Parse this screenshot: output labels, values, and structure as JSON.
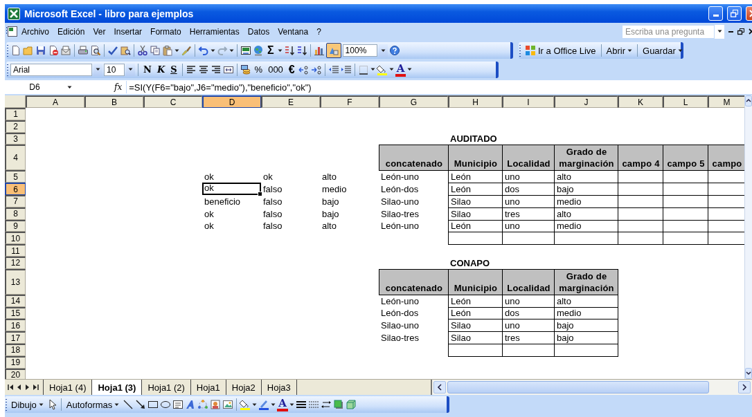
{
  "window": {
    "title": "Microsoft Excel - libro para ejemplos"
  },
  "menu_bar": {
    "items": [
      {
        "label": "Archivo"
      },
      {
        "label": "Edición"
      },
      {
        "label": "Ver"
      },
      {
        "label": "Insertar"
      },
      {
        "label": "Formato"
      },
      {
        "label": "Herramientas"
      },
      {
        "label": "Datos"
      },
      {
        "label": "Ventana"
      },
      {
        "label": "?"
      }
    ],
    "help_search": {
      "placeholder": "Escriba una pregunta"
    }
  },
  "standard_toolbar": {
    "sum_symbol": "Σ",
    "drawing_button": {
      "on": true
    },
    "zoom": "100%"
  },
  "office_live_toolbar": {
    "items": [
      {
        "label": "Ir a Office Live",
        "kind": "link"
      },
      {
        "label": "Abrir",
        "kind": "menu"
      },
      {
        "label": "Guardar",
        "kind": "menu"
      }
    ]
  },
  "format_toolbar": {
    "font": "Arial",
    "size": "10",
    "style_buttons": [
      {
        "label": "N",
        "kind": "bold"
      },
      {
        "label": "K",
        "kind": "italic"
      },
      {
        "label": "S",
        "kind": "underline"
      }
    ],
    "number_buttons": [
      {
        "label": "%",
        "kind": "percent"
      },
      {
        "label": "000",
        "kind": "thousands"
      },
      {
        "label": "€",
        "kind": "euro"
      }
    ],
    "font_color_glyph": "A"
  },
  "formula_bar": {
    "name_box": "D6",
    "fx": "fx",
    "formula": "=SI(Y(F6=\"bajo\",J6=\"medio\"),\"beneficio\",\"ok\")"
  },
  "sheet": {
    "columns": [
      {
        "label": "A",
        "selected": false
      },
      {
        "label": "B",
        "selected": false
      },
      {
        "label": "C",
        "selected": false
      },
      {
        "label": "D",
        "selected": true
      },
      {
        "label": "E",
        "selected": false
      },
      {
        "label": "F",
        "selected": false
      },
      {
        "label": "G",
        "selected": false
      },
      {
        "label": "H",
        "selected": false
      },
      {
        "label": "I",
        "selected": false
      },
      {
        "label": "J",
        "selected": false
      },
      {
        "label": "K",
        "selected": false
      },
      {
        "label": "L",
        "selected": false
      },
      {
        "label": "M",
        "selected": false
      }
    ],
    "rows": [
      {
        "number": "1",
        "selected": false
      },
      {
        "number": "2",
        "selected": false
      },
      {
        "number": "3",
        "selected": false,
        "cells": {
          "H": {
            "text": "AUDITADO",
            "kind": "title",
            "selected": false
          }
        }
      },
      {
        "number": "4",
        "selected": false,
        "cells": {
          "G": {
            "text": "concatenado",
            "kind": "header",
            "selected": false
          },
          "H": {
            "text": "Municipio",
            "kind": "header",
            "selected": false
          },
          "I": {
            "text": "Localidad",
            "kind": "header",
            "selected": false
          },
          "J": {
            "text": "Grado de marginación",
            "kind": "header",
            "selected": false
          },
          "K": {
            "text": "campo 4",
            "kind": "header",
            "selected": false
          },
          "L": {
            "text": "campo 5",
            "kind": "header",
            "selected": false
          },
          "M": {
            "text": "campo",
            "kind": "header",
            "selected": false
          }
        }
      },
      {
        "number": "5",
        "selected": false,
        "cells": {
          "D": {
            "text": "ok",
            "kind": "plain",
            "selected": false
          },
          "E": {
            "text": "ok",
            "kind": "plain",
            "selected": false
          },
          "F": {
            "text": "alto",
            "kind": "plain",
            "selected": false
          },
          "G": {
            "text": "León-uno",
            "kind": "plain",
            "selected": false
          },
          "H": {
            "text": "León",
            "kind": "boxed",
            "selected": false
          },
          "I": {
            "text": "uno",
            "kind": "boxed",
            "selected": false
          },
          "J": {
            "text": "alto",
            "kind": "boxed",
            "selected": false
          },
          "K": {
            "kind": "boxed",
            "selected": false
          },
          "L": {
            "kind": "boxed",
            "selected": false
          },
          "M": {
            "kind": "boxed",
            "selected": false
          }
        }
      },
      {
        "number": "6",
        "selected": true,
        "cells": {
          "D": {
            "text": "ok",
            "kind": "plain",
            "selected": true
          },
          "E": {
            "text": "falso",
            "kind": "plain",
            "selected": false
          },
          "F": {
            "text": "medio",
            "kind": "plain",
            "selected": false
          },
          "G": {
            "text": "León-dos",
            "kind": "plain",
            "selected": false
          },
          "H": {
            "text": "León",
            "kind": "boxed",
            "selected": false
          },
          "I": {
            "text": "dos",
            "kind": "boxed",
            "selected": false
          },
          "J": {
            "text": "bajo",
            "kind": "boxed",
            "selected": false
          },
          "K": {
            "kind": "boxed",
            "selected": false
          },
          "L": {
            "kind": "boxed",
            "selected": false
          },
          "M": {
            "kind": "boxed",
            "selected": false
          }
        }
      },
      {
        "number": "7",
        "selected": false,
        "cells": {
          "D": {
            "text": "beneficio",
            "kind": "plain",
            "selected": false
          },
          "E": {
            "text": "falso",
            "kind": "plain",
            "selected": false
          },
          "F": {
            "text": "bajo",
            "kind": "plain",
            "selected": false
          },
          "G": {
            "text": "Silao-uno",
            "kind": "plain",
            "selected": false
          },
          "H": {
            "text": "Silao",
            "kind": "boxed",
            "selected": false
          },
          "I": {
            "text": "uno",
            "kind": "boxed",
            "selected": false
          },
          "J": {
            "text": "medio",
            "kind": "boxed",
            "selected": false
          },
          "K": {
            "kind": "boxed",
            "selected": false
          },
          "L": {
            "kind": "boxed",
            "selected": false
          },
          "M": {
            "kind": "boxed",
            "selected": false
          }
        }
      },
      {
        "number": "8",
        "selected": false,
        "cells": {
          "D": {
            "text": "ok",
            "kind": "plain",
            "selected": false
          },
          "E": {
            "text": "falso",
            "kind": "plain",
            "selected": false
          },
          "F": {
            "text": "bajo",
            "kind": "plain",
            "selected": false
          },
          "G": {
            "text": "Silao-tres",
            "kind": "plain",
            "selected": false
          },
          "H": {
            "text": "Silao",
            "kind": "boxed",
            "selected": false
          },
          "I": {
            "text": "tres",
            "kind": "boxed",
            "selected": false
          },
          "J": {
            "text": "alto",
            "kind": "boxed",
            "selected": false
          },
          "K": {
            "kind": "boxed",
            "selected": false
          },
          "L": {
            "kind": "boxed",
            "selected": false
          },
          "M": {
            "kind": "boxed",
            "selected": false
          }
        }
      },
      {
        "number": "9",
        "selected": false,
        "cells": {
          "D": {
            "text": "ok",
            "kind": "plain",
            "selected": false
          },
          "E": {
            "text": "falso",
            "kind": "plain",
            "selected": false
          },
          "F": {
            "text": "alto",
            "kind": "plain",
            "selected": false
          },
          "G": {
            "text": "León-uno",
            "kind": "plain",
            "selected": false
          },
          "H": {
            "text": "León",
            "kind": "boxed",
            "selected": false
          },
          "I": {
            "text": "uno",
            "kind": "boxed",
            "selected": false
          },
          "J": {
            "text": "medio",
            "kind": "boxed",
            "selected": false
          },
          "K": {
            "kind": "boxed",
            "selected": false
          },
          "L": {
            "kind": "boxed",
            "selected": false
          },
          "M": {
            "kind": "boxed",
            "selected": false
          }
        }
      },
      {
        "number": "10",
        "selected": false,
        "cells": {
          "H": {
            "kind": "boxed",
            "selected": false
          },
          "I": {
            "kind": "boxed",
            "selected": false
          },
          "J": {
            "kind": "boxed",
            "selected": false
          },
          "K": {
            "kind": "boxed",
            "selected": false
          },
          "L": {
            "kind": "boxed",
            "selected": false
          },
          "M": {
            "kind": "boxed",
            "selected": false
          }
        }
      },
      {
        "number": "11",
        "selected": false
      },
      {
        "number": "12",
        "selected": false,
        "cells": {
          "H": {
            "text": "CONAPO",
            "kind": "title",
            "selected": false
          }
        }
      },
      {
        "number": "13",
        "selected": false,
        "cells": {
          "G": {
            "text": "concatenado",
            "kind": "header",
            "selected": false
          },
          "H": {
            "text": "Municipio",
            "kind": "header",
            "selected": false
          },
          "I": {
            "text": "Localidad",
            "kind": "header",
            "selected": false
          },
          "J": {
            "text": "Grado de marginación",
            "kind": "header",
            "selected": false
          }
        }
      },
      {
        "number": "14",
        "selected": false,
        "cells": {
          "G": {
            "text": "León-uno",
            "kind": "plain",
            "selected": false
          },
          "H": {
            "text": "León",
            "kind": "boxed",
            "selected": false
          },
          "I": {
            "text": "uno",
            "kind": "boxed",
            "selected": false
          },
          "J": {
            "text": "alto",
            "kind": "boxed",
            "selected": false
          }
        }
      },
      {
        "number": "15",
        "selected": false,
        "cells": {
          "G": {
            "text": "León-dos",
            "kind": "plain",
            "selected": false
          },
          "H": {
            "text": "León",
            "kind": "boxed",
            "selected": false
          },
          "I": {
            "text": "dos",
            "kind": "boxed",
            "selected": false
          },
          "J": {
            "text": "medio",
            "kind": "boxed",
            "selected": false
          }
        }
      },
      {
        "number": "16",
        "selected": false,
        "cells": {
          "G": {
            "text": "Silao-uno",
            "kind": "plain",
            "selected": false
          },
          "H": {
            "text": "Silao",
            "kind": "boxed",
            "selected": false
          },
          "I": {
            "text": "uno",
            "kind": "boxed",
            "selected": false
          },
          "J": {
            "text": "bajo",
            "kind": "boxed",
            "selected": false
          }
        }
      },
      {
        "number": "17",
        "selected": false,
        "cells": {
          "G": {
            "text": "Silao-tres",
            "kind": "plain",
            "selected": false
          },
          "H": {
            "text": "Silao",
            "kind": "boxed",
            "selected": false
          },
          "I": {
            "text": "tres",
            "kind": "boxed",
            "selected": false
          },
          "J": {
            "text": "bajo",
            "kind": "boxed",
            "selected": false
          }
        }
      },
      {
        "number": "18",
        "selected": false,
        "cells": {
          "H": {
            "kind": "boxed",
            "selected": false
          },
          "I": {
            "kind": "boxed",
            "selected": false
          },
          "J": {
            "kind": "boxed",
            "selected": false
          }
        }
      },
      {
        "number": "19",
        "selected": false
      },
      {
        "number": "20",
        "selected": false
      }
    ]
  },
  "sheet_tabs": [
    {
      "label": "Hoja1 (4)",
      "selected": false
    },
    {
      "label": "Hoja1 (3)",
      "selected": true
    },
    {
      "label": "Hoja1 (2)",
      "selected": false
    },
    {
      "label": "Hoja1",
      "selected": false
    },
    {
      "label": "Hoja2",
      "selected": false
    },
    {
      "label": "Hoja3",
      "selected": false
    }
  ],
  "drawing_toolbar": {
    "draw_menu": "Dibujo",
    "autoshapes_menu": "Autoformas",
    "font_color_glyph": "A"
  }
}
